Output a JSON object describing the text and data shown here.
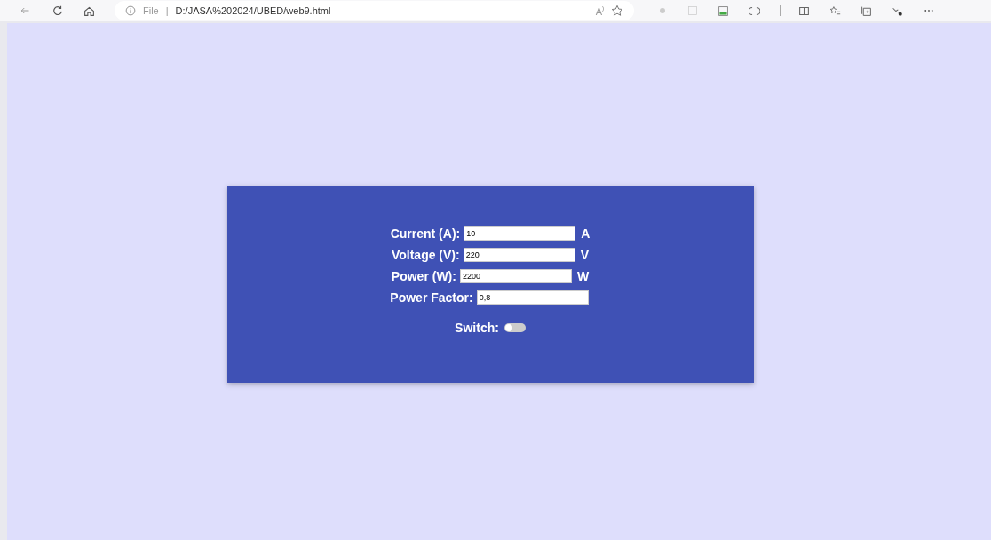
{
  "browser": {
    "scheme_label": "File",
    "separator": "|",
    "address": "D:/JASA%202024/UBED/web9.html",
    "read_aloud": "A⁾"
  },
  "fields": [
    {
      "label": "Current (A):",
      "value": "10",
      "unit": "A"
    },
    {
      "label": "Voltage (V):",
      "value": "220",
      "unit": "V"
    },
    {
      "label": "Power (W):",
      "value": "2200",
      "unit": "W"
    },
    {
      "label": "Power Factor:",
      "value": "0,8"
    }
  ],
  "switch": {
    "label": "Switch:",
    "on": false
  }
}
